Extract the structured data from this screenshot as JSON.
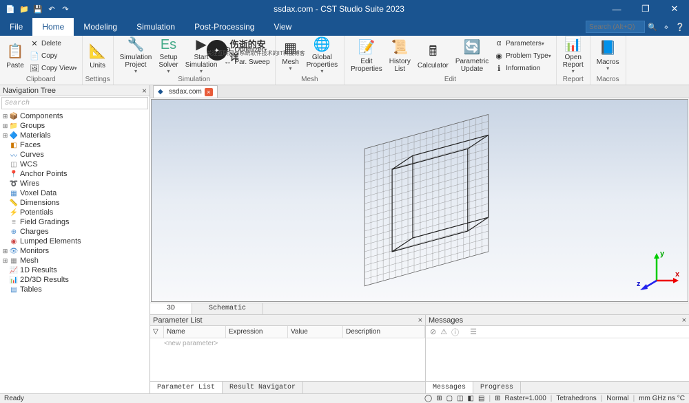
{
  "window": {
    "title": "ssdax.com - CST Studio Suite 2023"
  },
  "menu": {
    "file": "File",
    "tabs": [
      "Home",
      "Modeling",
      "Simulation",
      "Post-Processing",
      "View"
    ],
    "active": "Home",
    "search_placeholder": "Search (Alt+Q)"
  },
  "ribbon": {
    "clipboard": {
      "label": "Clipboard",
      "paste": "Paste",
      "delete": "Delete",
      "copy": "Copy",
      "copy_view": "Copy View"
    },
    "settings": {
      "label": "Settings",
      "units": "Units"
    },
    "simulation": {
      "label": "Simulation",
      "project": "Simulation\nProject",
      "solver": "Setup\nSolver",
      "start": "Start\nSimulation",
      "optimizer": "Optimizer",
      "par_sweep": "Par. Sweep"
    },
    "mesh": {
      "label": "Mesh",
      "mesh": "Mesh",
      "global": "Global\nProperties"
    },
    "edit": {
      "label": "Edit",
      "properties": "Edit\nProperties",
      "history": "History\nList",
      "calculator": "Calculator",
      "parametric": "Parametric\nUpdate",
      "parameters": "Parameters",
      "problem_type": "Problem Type",
      "information": "Information"
    },
    "report": {
      "label": "Report",
      "open_report": "Open\nReport"
    },
    "macros": {
      "label": "Macros",
      "macros": "Macros"
    }
  },
  "nav": {
    "title": "Navigation Tree",
    "search": "Search",
    "items": [
      {
        "exp": "⊞",
        "icon": "📦",
        "label": "Components",
        "c": "#4a8"
      },
      {
        "exp": "⊞",
        "icon": "📁",
        "label": "Groups",
        "c": "#888"
      },
      {
        "exp": "⊞",
        "icon": "🔷",
        "label": "Materials",
        "c": "#4a8"
      },
      {
        "exp": "",
        "icon": "◧",
        "label": "Faces",
        "c": "#c70"
      },
      {
        "exp": "",
        "icon": "〰",
        "label": "Curves",
        "c": "#48c"
      },
      {
        "exp": "",
        "icon": "◫",
        "label": "WCS",
        "c": "#888"
      },
      {
        "exp": "",
        "icon": "📍",
        "label": "Anchor Points",
        "c": "#c44"
      },
      {
        "exp": "",
        "icon": "➰",
        "label": "Wires",
        "c": "#c70"
      },
      {
        "exp": "",
        "icon": "▦",
        "label": "Voxel Data",
        "c": "#48c"
      },
      {
        "exp": "",
        "icon": "📏",
        "label": "Dimensions",
        "c": "#888"
      },
      {
        "exp": "",
        "icon": "⚡",
        "label": "Potentials",
        "c": "#c70"
      },
      {
        "exp": "",
        "icon": "≡",
        "label": "Field Gradings",
        "c": "#888"
      },
      {
        "exp": "",
        "icon": "⊕",
        "label": "Charges",
        "c": "#48c"
      },
      {
        "exp": "",
        "icon": "◉",
        "label": "Lumped Elements",
        "c": "#c44"
      },
      {
        "exp": "⊞",
        "icon": "👁",
        "label": "Monitors",
        "c": "#48c"
      },
      {
        "exp": "⊞",
        "icon": "▦",
        "label": "Mesh",
        "c": "#888"
      },
      {
        "exp": "",
        "icon": "📈",
        "label": "1D Results",
        "c": "#4a8"
      },
      {
        "exp": "",
        "icon": "📊",
        "label": "2D/3D Results",
        "c": "#4a8"
      },
      {
        "exp": "",
        "icon": "▤",
        "label": "Tables",
        "c": "#48c"
      }
    ]
  },
  "doc": {
    "name": "ssdax.com"
  },
  "view_tabs": {
    "t3d": "3D",
    "schematic": "Schematic"
  },
  "param": {
    "title": "Parameter List",
    "cols": [
      "",
      "Name",
      "Expression",
      "Value",
      "Description"
    ],
    "placeholder": "<new parameter>",
    "tab1": "Parameter List",
    "tab2": "Result Navigator"
  },
  "messages": {
    "title": "Messages",
    "tab1": "Messages",
    "tab2": "Progress"
  },
  "status": {
    "ready": "Ready",
    "raster": "Raster=1.000",
    "mesh": "Tetrahedrons",
    "accuracy": "Normal",
    "units": "mm GHz ns °C"
  },
  "watermark": {
    "text": "伤逝的安详",
    "sub": "关注互联网与系统软件技术的IT科技博客"
  }
}
